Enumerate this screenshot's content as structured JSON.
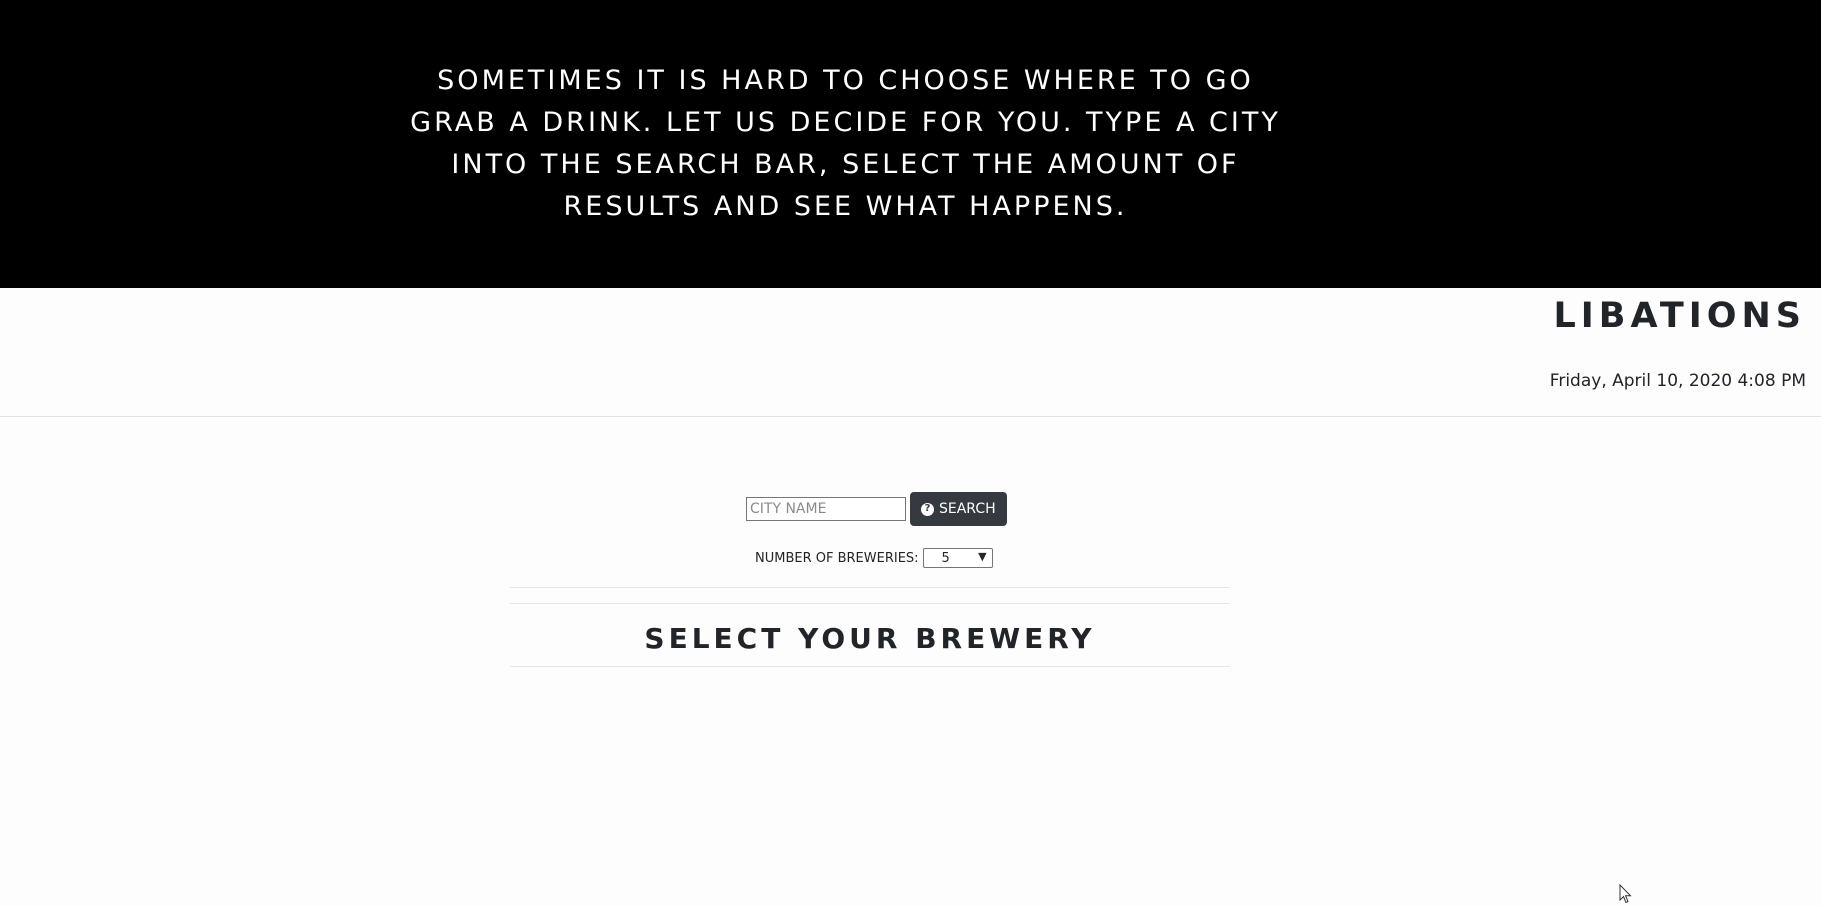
{
  "hero": {
    "text": "SOMETIMES IT IS HARD TO CHOOSE WHERE TO GO GRAB A DRINK. LET US DECIDE FOR YOU. TYPE A CITY INTO THE SEARCH BAR, SELECT THE AMOUNT OF RESULTS AND SEE WHAT HAPPENS."
  },
  "header": {
    "brand": "LIBATIONS",
    "datetime": "Friday, April 10, 2020 4:08 PM"
  },
  "search": {
    "placeholder": "CITY NAME",
    "value": "",
    "button_label": "SEARCH",
    "button_icon": "question-circle-icon"
  },
  "count": {
    "label": "NUMBER OF BREWERIES:",
    "selected": "5"
  },
  "results": {
    "title": "SELECT YOUR BREWERY"
  },
  "colors": {
    "hero_bg": "#000000",
    "button_bg": "#343a40",
    "text": "#212529"
  }
}
